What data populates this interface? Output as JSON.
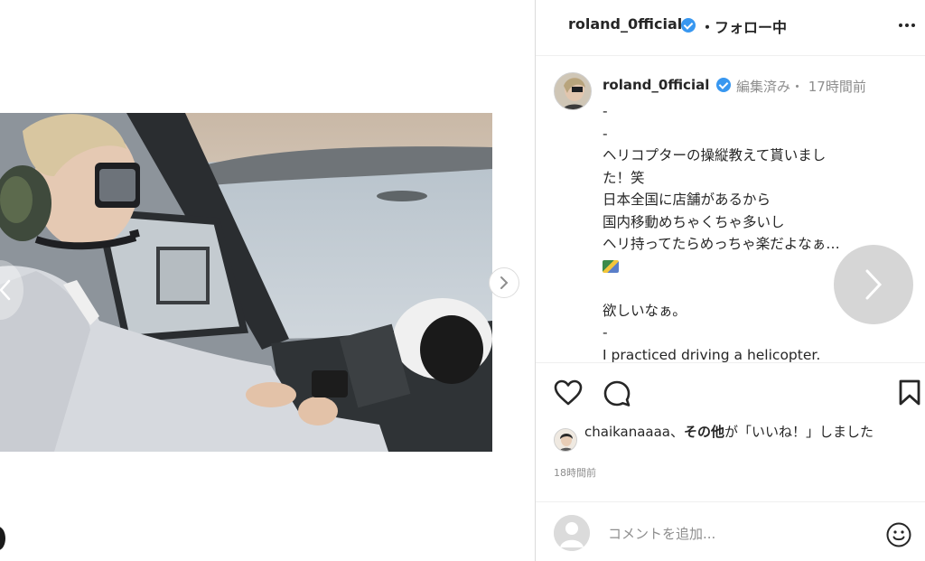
{
  "header": {
    "username": "roland_0fficial",
    "follow_status": "・フォロー中"
  },
  "caption": {
    "username": "roland_0fficial",
    "meta": "編集済み・ 17時間前",
    "lines": [
      "-",
      "-",
      "ヘリコプターの操縦教えて貰いまし",
      "た！笑",
      "日本全国に店舗があるから",
      "国内移動めちゃくちゃ多いし",
      "ヘリ持ってたらめっちゃ楽だよなぁ…",
      "",
      "欲しいなぁ。",
      "-",
      "I practiced driving a helicopter."
    ]
  },
  "likes": {
    "user": "chaikanaaaa",
    "separator": "、",
    "others": "その他",
    "suffix": "が「いいね！」しました"
  },
  "timestamp": "18時間前",
  "comment": {
    "placeholder": "コメントを追加..."
  },
  "icons": {
    "verified": "verified-badge-icon",
    "more": "more-options-icon",
    "like": "heart-icon",
    "comment": "comment-icon",
    "save": "bookmark-icon",
    "next": "chevron-right-icon",
    "prev": "chevron-left-icon",
    "emoji": "smiley-icon"
  },
  "colors": {
    "verified": "#3897f0",
    "muted_text": "#8e8e8e",
    "text": "#262626"
  }
}
